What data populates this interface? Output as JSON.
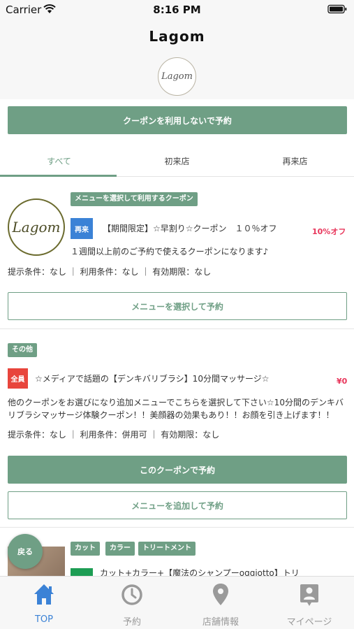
{
  "status_bar": {
    "carrier": "Carrier",
    "time": "8:16 PM"
  },
  "header": {
    "title": "Lagom",
    "logo_text": "Lagom"
  },
  "no_coupon_button": "クーポンを利用しないで予約",
  "tabs": [
    {
      "label": "すべて",
      "active": true
    },
    {
      "label": "初来店",
      "active": false
    },
    {
      "label": "再来店",
      "active": false
    }
  ],
  "coupons": [
    {
      "logo_text": "Lagom",
      "tags": [
        "メニューを選択して利用するクーポン"
      ],
      "badge": "再来",
      "badge_color": "#3b82d6",
      "title": "【期間限定】☆早割り☆クーポン　１０％オフ",
      "discount": "10%オフ",
      "description": "１週間以上前のご予約で使えるクーポンになります♪",
      "conditions": "提示条件：なし ｜ 利用条件：なし ｜ 有効期限：なし",
      "buttons": [
        "メニューを選択して予約"
      ]
    },
    {
      "tags": [
        "その他"
      ],
      "badge": "全員",
      "badge_color": "#e8453c",
      "title": "☆メディアで話題の【デンキバリブラシ】10分間マッサージ☆",
      "discount": "¥0",
      "description": "他のクーポンをお選びになり追加メニューでこちらを選択して下さい☆10分間のデンキバリブラシマッサージ体験クーポン！！美顔器の効果もあり！！お顔を引き上げます！！",
      "conditions": "提示条件：なし ｜ 利用条件：併用可 ｜ 有効期限：なし",
      "buttons": [
        "このクーポンで予約",
        "メニューを追加して予約"
      ]
    },
    {
      "tags": [
        "カット",
        "カラー",
        "トリートメント"
      ],
      "title": "カット+カラー+【魔法のシャンプーoggiotto】トリ"
    }
  ],
  "back_button": "戻る",
  "tab_bar": [
    {
      "label": "TOP",
      "icon": "home-icon",
      "active": true
    },
    {
      "label": "予約",
      "icon": "clock-icon",
      "active": false
    },
    {
      "label": "店舗情報",
      "icon": "location-pin-icon",
      "active": false
    },
    {
      "label": "マイページ",
      "icon": "person-badge-icon",
      "active": false
    }
  ],
  "colors": {
    "accent": "#6f9f85",
    "discount": "#e8365b",
    "active_tab": "#3b82d6"
  }
}
